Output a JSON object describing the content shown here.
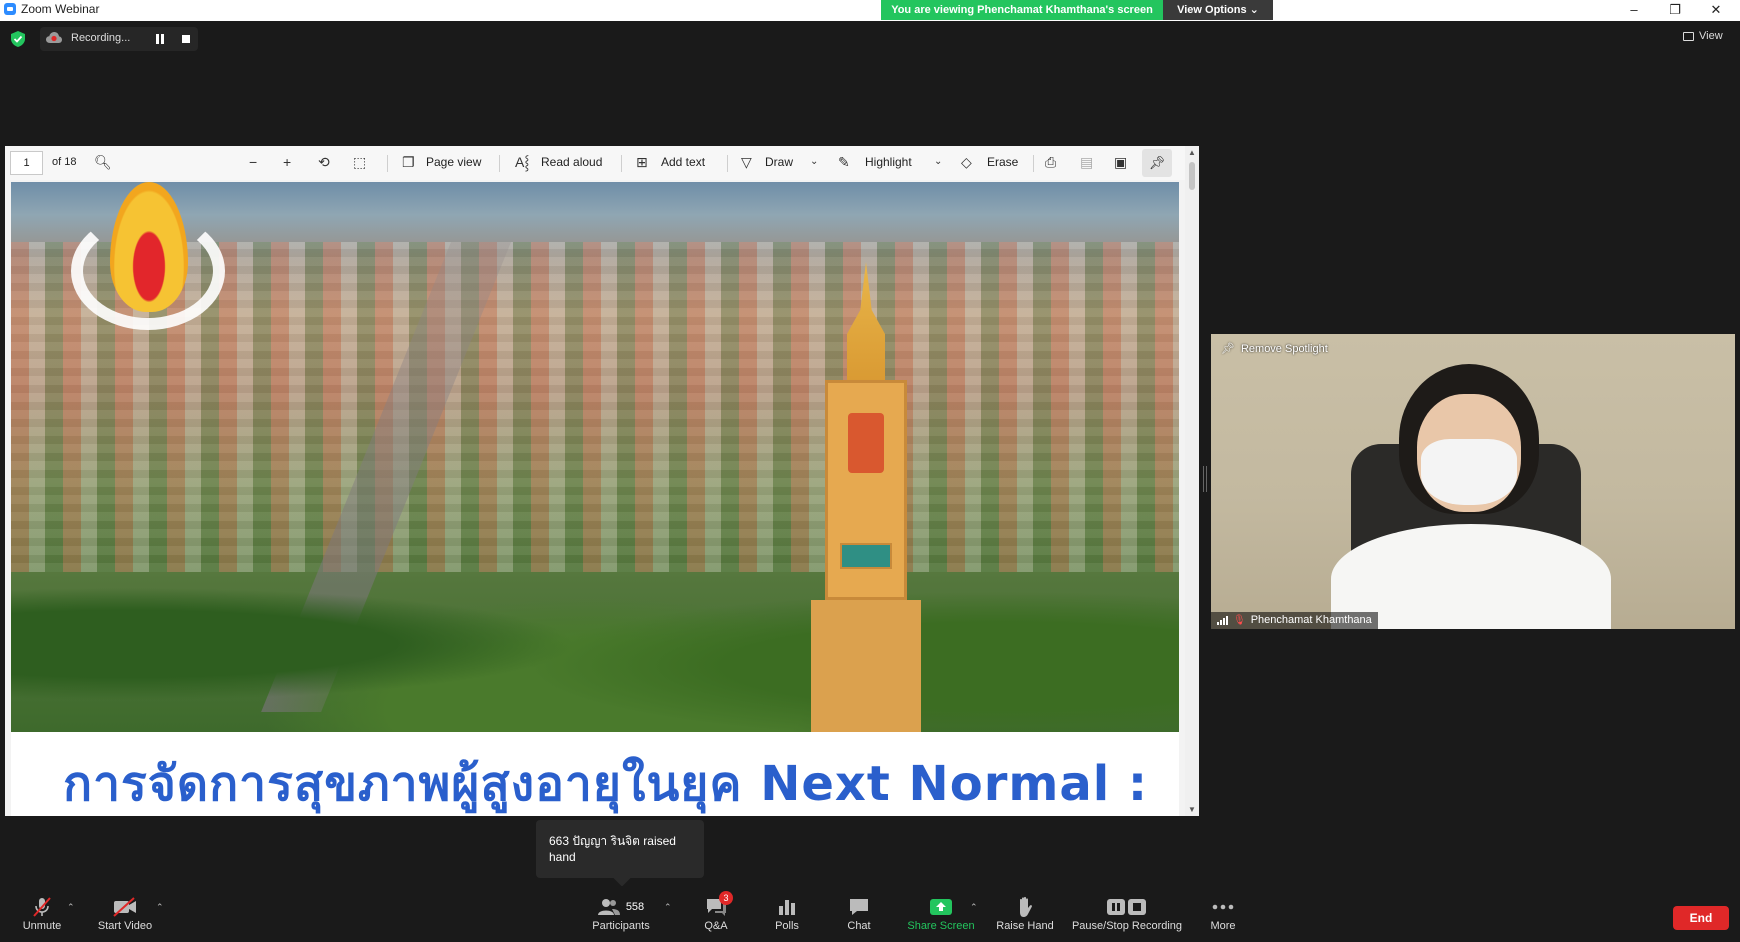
{
  "window": {
    "title": "Zoom Webinar",
    "viewing_banner": "You are viewing Phenchamat Khamthana's screen",
    "view_options": "View Options",
    "minimize": "–",
    "restore": "❐",
    "close": "✕"
  },
  "status": {
    "recording_label": "Recording...",
    "view_label": "View"
  },
  "pdf_toolbar": {
    "page_number": "1",
    "page_total": "of 18",
    "page_view": "Page view",
    "read_aloud": "Read aloud",
    "add_text": "Add text",
    "draw": "Draw",
    "highlight": "Highlight",
    "erase": "Erase"
  },
  "slide": {
    "caption": "การจัดการสุขภาพผู้สูงอายุในยุค Next  Normal :"
  },
  "video": {
    "remove_spotlight": "Remove Spotlight",
    "participant_name": "Phenchamat Khamthana"
  },
  "notice": {
    "text": "663 ปัญญา รินจิต raised hand"
  },
  "toolbar": {
    "unmute": "Unmute",
    "start_video": "Start Video",
    "participants": "Participants",
    "participant_count": "558",
    "qa": "Q&A",
    "qa_badge": "3",
    "polls": "Polls",
    "chat": "Chat",
    "share_screen": "Share Screen",
    "raise_hand": "Raise Hand",
    "pause_stop_recording": "Pause/Stop Recording",
    "more": "More",
    "end": "End"
  },
  "colors": {
    "viewing_banner": "#23c55e",
    "share_screen": "#23c55e",
    "end_button": "#e02828",
    "caption_text": "#2a5fcc"
  }
}
